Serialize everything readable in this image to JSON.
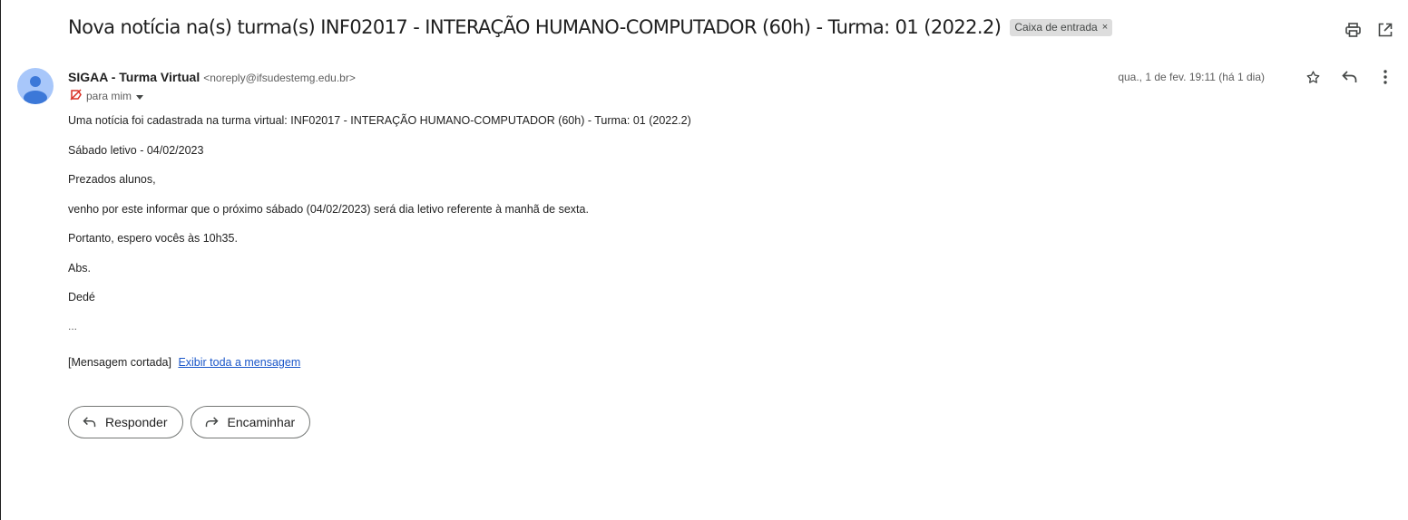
{
  "subject": "Nova notícia na(s) turma(s) INF02017 - INTERAÇÃO HUMANO-COMPUTADOR (60h) - Turma: 01 (2022.2)",
  "label_chip": {
    "text": "Caixa de entrada",
    "remove": "×"
  },
  "top_actions": {
    "print_icon": "print-icon",
    "open_new_window_icon": "open-in-new-window-icon"
  },
  "sender": {
    "name": "SIGAA - Turma Virtual",
    "email": "<noreply@ifsudestemg.edu.br>",
    "to": "para mim"
  },
  "date": "qua., 1 de fev. 19:11 (há 1 dia)",
  "body": {
    "lines": [
      "Uma notícia foi cadastrada na turma virtual: INF02017 - INTERAÇÃO HUMANO-COMPUTADOR (60h) - Turma: 01 (2022.2)",
      "Sábado letivo - 04/02/2023",
      "Prezados alunos,",
      "venho por este informar que o próximo sábado (04/02/2023) será dia letivo referente à manhã de sexta.",
      "Portanto, espero vocês às 10h35.",
      "Abs.",
      "Dedé"
    ],
    "ellipsis": "...",
    "trimmed_label": "[Mensagem cortada]",
    "show_full_link": "Exibir toda a mensagem"
  },
  "actions": {
    "reply": "Responder",
    "forward": "Encaminhar"
  },
  "colors": {
    "avatar": "#a8c7fa",
    "avatar_figure": "#3c78d8",
    "link": "#1a56c9",
    "chip_bg": "#dddddd"
  }
}
